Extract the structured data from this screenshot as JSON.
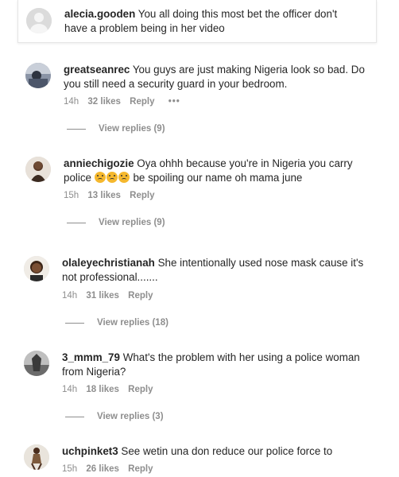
{
  "top_comment": {
    "username": "alecia.gooden",
    "text": "You all doing this most bet the officer don't",
    "text2": "have a problem being in her video"
  },
  "comments": [
    {
      "username": "greatseanrec",
      "line1": "You guys are just making Nigeria look so bad. Do",
      "line2": "you still need a security guard in your bedroom.",
      "time": "14h",
      "likes": "32 likes",
      "reply": "Reply",
      "more": "•••",
      "view_replies": "View replies (9)"
    },
    {
      "username": "anniechigozie",
      "line1": "Oya ohhh because you're in Nigeria you carry",
      "line2a": "police",
      "line2b": "be spoiling our name oh mama june",
      "time": "15h",
      "likes": "13 likes",
      "reply": "Reply",
      "view_replies": "View replies (9)"
    },
    {
      "username": "olaleyechristianah",
      "line1": "She intentionally used nose mask cause it's",
      "line2": "not professional.......",
      "time": "14h",
      "likes": "31 likes",
      "reply": "Reply",
      "view_replies": "View replies (18)"
    },
    {
      "username": "3_mmm_79",
      "line1": "What's the problem with her using a police woman",
      "line2": "from Nigeria?",
      "time": "14h",
      "likes": "18 likes",
      "reply": "Reply",
      "view_replies": "View replies (3)"
    },
    {
      "username": "uchpinket3",
      "line1": "See wetin una don reduce our police force to",
      "time": "15h",
      "likes": "26 likes",
      "reply": "Reply"
    }
  ],
  "icons": {
    "emoji": "worried-face-emoji",
    "avatar": "avatar"
  }
}
